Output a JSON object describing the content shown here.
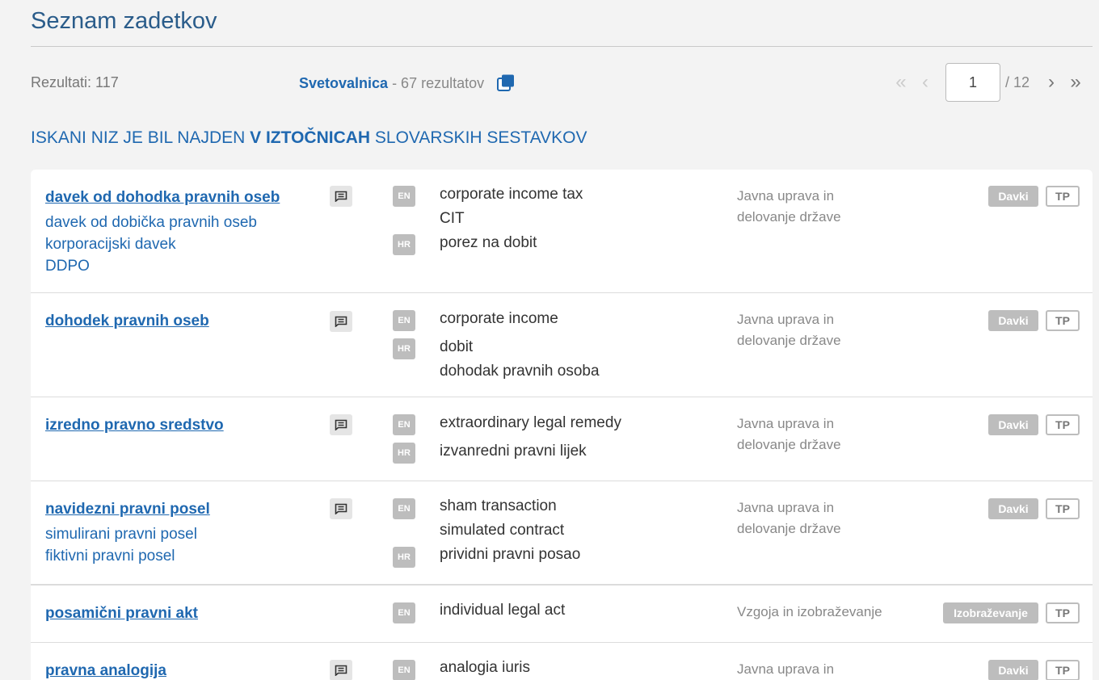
{
  "page_title": "Seznam zadetkov",
  "results_count": "Rezultati: 117",
  "counsel": {
    "link": "Svetovalnica",
    "suffix": " - 67 rezultatov"
  },
  "pager": {
    "current": "1",
    "total": "/ 12"
  },
  "heading": {
    "part1": "ISKANI NIZ JE BIL NAJDEN ",
    "bold": "V IZTOČNICAH",
    "part2": " SLOVARSKIH SESTAVKOV"
  },
  "entries": [
    {
      "term": "davek od dohodka pravnih oseb",
      "synonyms": [
        "davek od dobička pravnih oseb",
        "korporacijski davek",
        "DDPO"
      ],
      "has_note": true,
      "langs": [
        "EN",
        "HR"
      ],
      "equivalents": [
        "corporate income tax",
        "CIT",
        "porez na dobit"
      ],
      "domain": "Javna uprava in delovanje države",
      "tag": "Davki",
      "source": "TP"
    },
    {
      "term": "dohodek pravnih oseb",
      "synonyms": [],
      "has_note": true,
      "langs": [
        "EN",
        "HR"
      ],
      "equivalents": [
        "corporate income",
        "dobit",
        "dohodak pravnih osoba"
      ],
      "domain": "Javna uprava in delovanje države",
      "tag": "Davki",
      "source": "TP"
    },
    {
      "term": "izredno pravno sredstvo",
      "synonyms": [],
      "has_note": true,
      "langs": [
        "EN",
        "HR"
      ],
      "equivalents": [
        "extraordinary legal remedy",
        "izvanredni pravni lijek"
      ],
      "domain": "Javna uprava in delovanje države",
      "tag": "Davki",
      "source": "TP"
    },
    {
      "term": "navidezni pravni posel",
      "synonyms": [
        "simulirani pravni posel",
        "fiktivni pravni posel"
      ],
      "has_note": true,
      "langs": [
        "EN",
        "HR"
      ],
      "equivalents": [
        "sham transaction",
        "simulated contract",
        "prividni pravni posao"
      ],
      "domain": "Javna uprava in delovanje države",
      "tag": "Davki",
      "source": "TP"
    },
    {
      "term": "posamični pravni akt",
      "synonyms": [],
      "has_note": false,
      "langs": [
        "EN"
      ],
      "equivalents": [
        "individual legal act"
      ],
      "domain": "Vzgoja in izobraževanje",
      "tag": "Izobraževanje",
      "source": "TP"
    },
    {
      "term": "pravna analogija",
      "synonyms": [],
      "has_note": true,
      "langs": [
        "EN"
      ],
      "equivalents": [
        "analogia iuris"
      ],
      "domain": "Javna uprava in",
      "tag": "Davki",
      "source": "TP"
    }
  ]
}
